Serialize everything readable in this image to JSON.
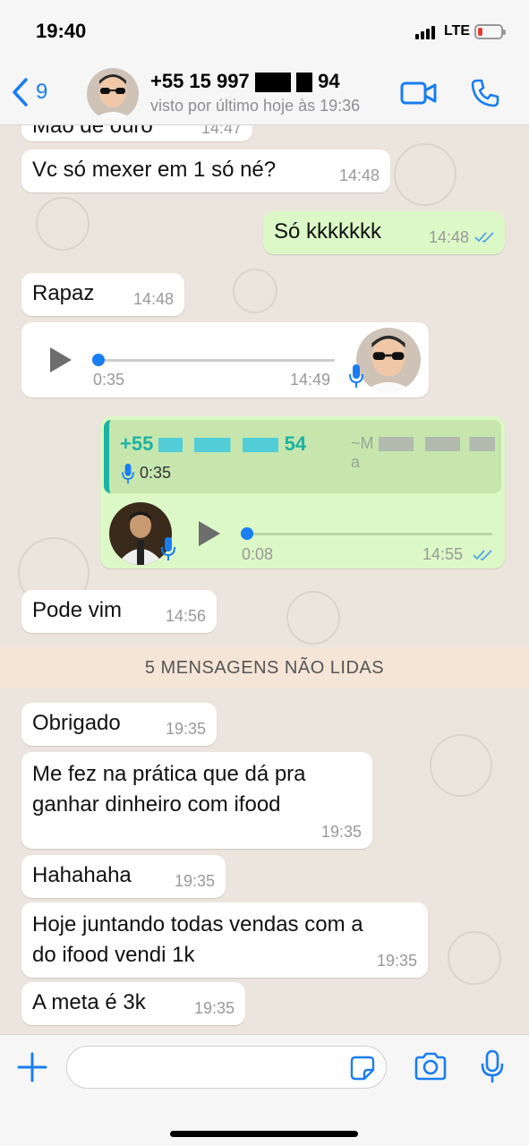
{
  "status_bar": {
    "time": "19:40",
    "network": "LTE"
  },
  "header": {
    "back_count": "9",
    "contact_name_visible": "+55 15 997",
    "contact_name_tail": "94",
    "last_seen": "visto por último hoje às 19:36"
  },
  "messages": [
    {
      "direction": "in",
      "text": "Mão de ouro",
      "time": "14:47"
    },
    {
      "direction": "in",
      "text": "Vc só mexer em 1 só né?",
      "time": "14:48"
    },
    {
      "direction": "out",
      "text": "Só kkkkkkk",
      "time": "14:48"
    },
    {
      "direction": "in",
      "text": "Rapaz",
      "time": "14:48"
    },
    {
      "direction": "in",
      "type": "voice",
      "duration": "0:35",
      "time": "14:49"
    },
    {
      "direction": "out",
      "type": "voice-reply",
      "quoted_number": "+55",
      "quoted_number_tail": "54",
      "quoted_name_prefix": "~M",
      "quoted_name_tail": "a",
      "quoted_duration": "0:35",
      "duration": "0:08",
      "time": "14:55"
    },
    {
      "direction": "in",
      "text": "Pode vim",
      "time": "14:56"
    }
  ],
  "unread_separator": "5 MENSAGENS NÃO LIDAS",
  "unread_messages": [
    {
      "text": "Obrigado",
      "time": "19:35"
    },
    {
      "line1": "Me fez na prática que dá pra",
      "line2": "ganhar dinheiro com ifood",
      "time": "19:35"
    },
    {
      "text": "Hahahaha",
      "time": "19:35"
    },
    {
      "line1": "Hoje juntando todas vendas com a",
      "line2": "do ifood vendi 1k",
      "time": "19:35"
    },
    {
      "text": "A meta é 3k",
      "time": "19:35"
    }
  ],
  "colors": {
    "accent": "#1a7df2",
    "outgoing_bubble": "#dcf8c6",
    "incoming_bubble": "#ffffff",
    "chat_bg": "#ece5dd",
    "reply_bar": "#1cb3a4"
  },
  "icons": [
    "back-chevron-icon",
    "video-call-icon",
    "phone-call-icon",
    "plus-icon",
    "sticker-icon",
    "camera-icon",
    "microphone-icon",
    "play-icon",
    "double-check-icon"
  ]
}
